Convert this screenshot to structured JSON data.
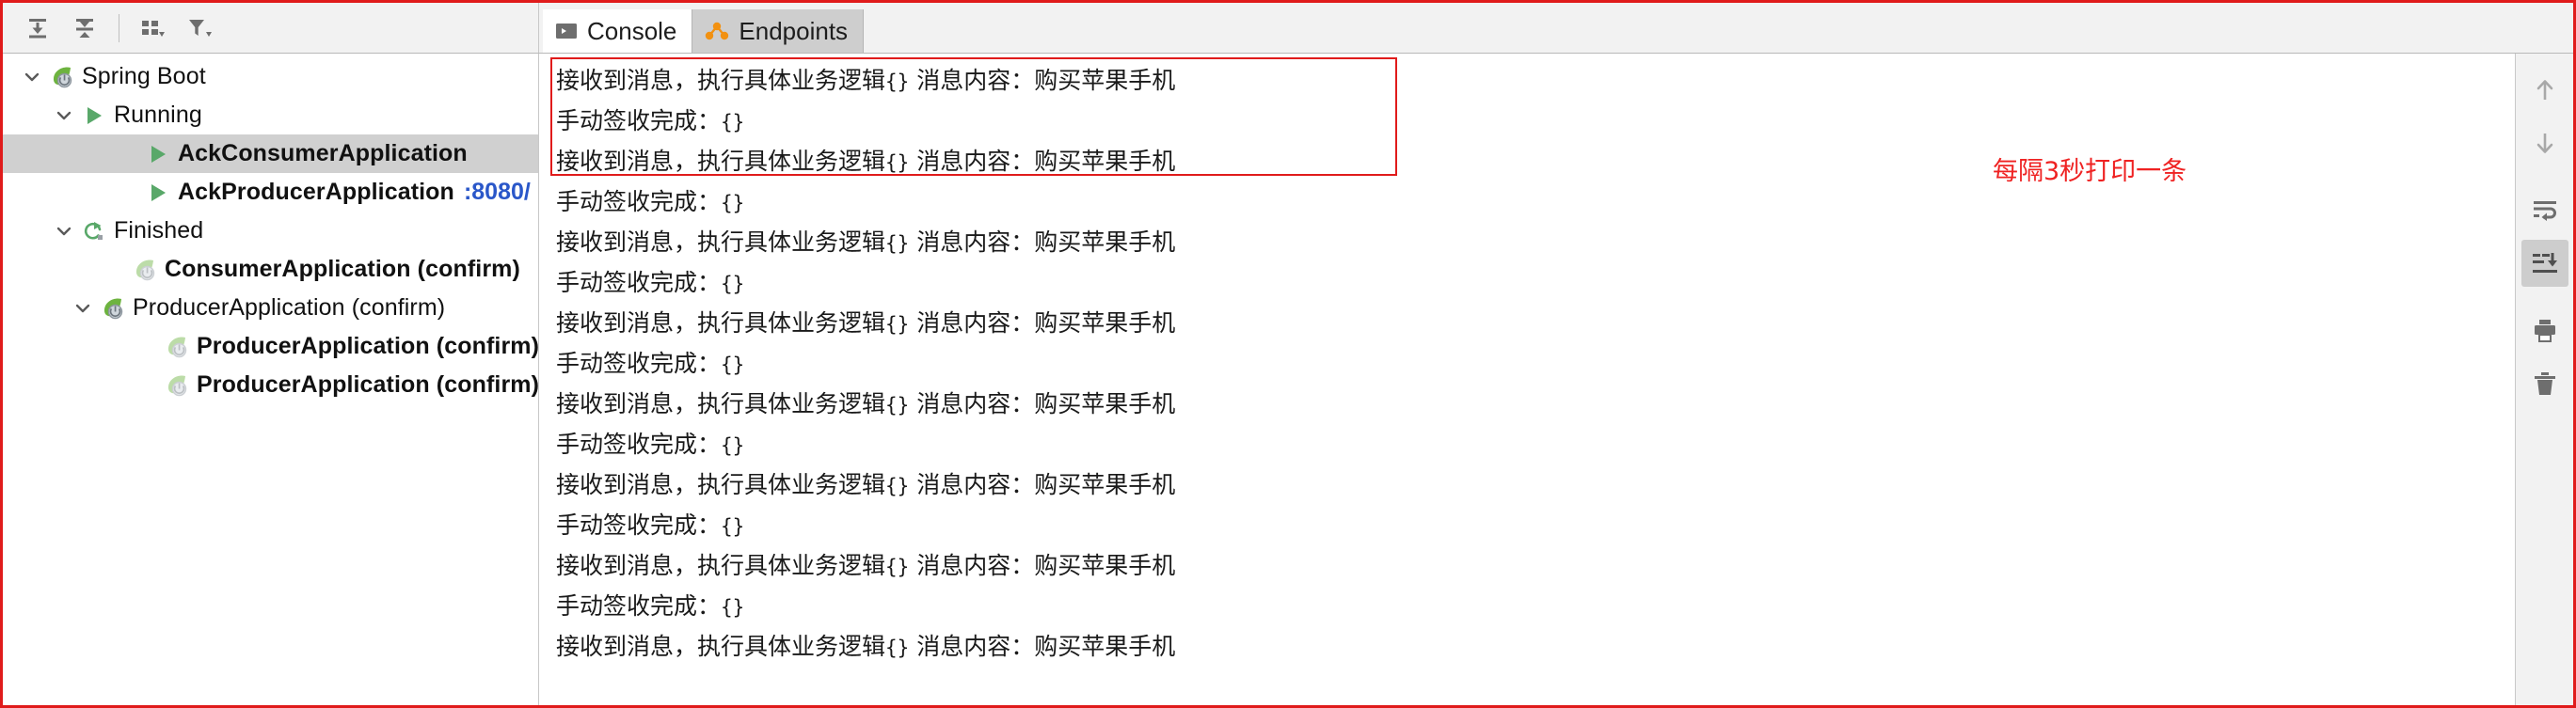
{
  "toolbar": {
    "buttons": [
      {
        "name": "expand-all-button",
        "icon": "expand-all-icon",
        "tooltip": "Expand All"
      },
      {
        "name": "collapse-all-button",
        "icon": "collapse-all-icon",
        "tooltip": "Collapse All"
      },
      {
        "name": "group-by-button",
        "icon": "group-by-icon",
        "tooltip": "Group By"
      },
      {
        "name": "filter-button",
        "icon": "filter-icon",
        "tooltip": "Filter"
      }
    ]
  },
  "tabs": [
    {
      "label": "Console",
      "icon": "console-icon",
      "active": true
    },
    {
      "label": "Endpoints",
      "icon": "endpoints-icon",
      "active": false
    }
  ],
  "tree": {
    "rows": [
      {
        "label": "Spring Boot",
        "icon": "spring-boot-icon",
        "indent": 0,
        "twisty": "down",
        "bold": false,
        "selected": false,
        "sub": ""
      },
      {
        "label": "Running",
        "icon": "run-green-icon",
        "indent": 1,
        "twisty": "down",
        "bold": false,
        "selected": false,
        "sub": ""
      },
      {
        "label": "AckConsumerApplication",
        "icon": "run-green-icon",
        "indent": 2,
        "twisty": "none",
        "bold": true,
        "selected": true,
        "sub": ""
      },
      {
        "label": "AckProducerApplication",
        "icon": "run-green-icon",
        "indent": 2,
        "twisty": "none",
        "bold": true,
        "selected": false,
        "sub": ":8080/"
      },
      {
        "label": "Finished",
        "icon": "rerun-green-icon",
        "indent": 1,
        "twisty": "down",
        "bold": false,
        "selected": false,
        "sub": ""
      },
      {
        "label": "ConsumerApplication (confirm)",
        "icon": "spring-boot-faded-icon",
        "indent": 2,
        "twisty": "none",
        "bold": true,
        "selected": false,
        "sub": ""
      },
      {
        "label": "ProducerApplication (confirm)",
        "icon": "spring-boot-icon",
        "indent": 2,
        "twisty": "down",
        "bold": false,
        "selected": false,
        "sub": ""
      },
      {
        "label": "ProducerApplication (confirm)",
        "icon": "spring-boot-faded-icon",
        "indent": 3,
        "twisty": "none",
        "bold": true,
        "selected": false,
        "sub": ""
      },
      {
        "label": "ProducerApplication (confirm)",
        "icon": "spring-boot-faded-icon",
        "indent": 3,
        "twisty": "none",
        "bold": true,
        "selected": false,
        "sub": ""
      }
    ]
  },
  "console": {
    "lines": [
      {
        "text": "接收到消息，执行具体业务逻辑",
        "braces": "{}",
        "tail": " 消息内容：购买苹果手机"
      },
      {
        "text": "手动签收完成：",
        "braces": "{}",
        "tail": ""
      },
      {
        "text": "接收到消息，执行具体业务逻辑",
        "braces": "{}",
        "tail": " 消息内容：购买苹果手机"
      },
      {
        "text": "手动签收完成：",
        "braces": "{}",
        "tail": ""
      },
      {
        "text": "接收到消息，执行具体业务逻辑",
        "braces": "{}",
        "tail": " 消息内容：购买苹果手机"
      },
      {
        "text": "手动签收完成：",
        "braces": "{}",
        "tail": ""
      },
      {
        "text": "接收到消息，执行具体业务逻辑",
        "braces": "{}",
        "tail": " 消息内容：购买苹果手机"
      },
      {
        "text": "手动签收完成：",
        "braces": "{}",
        "tail": ""
      },
      {
        "text": "接收到消息，执行具体业务逻辑",
        "braces": "{}",
        "tail": " 消息内容：购买苹果手机"
      },
      {
        "text": "手动签收完成：",
        "braces": "{}",
        "tail": ""
      },
      {
        "text": "接收到消息，执行具体业务逻辑",
        "braces": "{}",
        "tail": " 消息内容：购买苹果手机"
      },
      {
        "text": "手动签收完成：",
        "braces": "{}",
        "tail": ""
      },
      {
        "text": "接收到消息，执行具体业务逻辑",
        "braces": "{}",
        "tail": " 消息内容：购买苹果手机"
      },
      {
        "text": "手动签收完成：",
        "braces": "{}",
        "tail": ""
      },
      {
        "text": "接收到消息，执行具体业务逻辑",
        "braces": "{}",
        "tail": " 消息内容：购买苹果手机"
      }
    ],
    "annotation": "每隔3秒打印一条"
  },
  "console_sidebar": {
    "buttons": [
      {
        "name": "scroll-up-button",
        "icon": "arrow-up-icon",
        "active": false
      },
      {
        "name": "scroll-down-button",
        "icon": "arrow-down-icon",
        "active": false
      },
      {
        "name": "soft-wrap-button",
        "icon": "soft-wrap-icon",
        "active": false
      },
      {
        "name": "scroll-to-end-button",
        "icon": "scroll-to-end-icon",
        "active": true
      },
      {
        "name": "print-button",
        "icon": "print-icon",
        "active": false
      },
      {
        "name": "clear-all-button",
        "icon": "trash-icon",
        "active": false
      }
    ]
  },
  "colors": {
    "annotation_red": "#ef2222",
    "border_red": "#e01b1b",
    "link_blue": "#2a57c9",
    "spring_green": "#6db33f",
    "endpoint_orange": "#f29111",
    "selection_gray": "#d0d0d0"
  }
}
